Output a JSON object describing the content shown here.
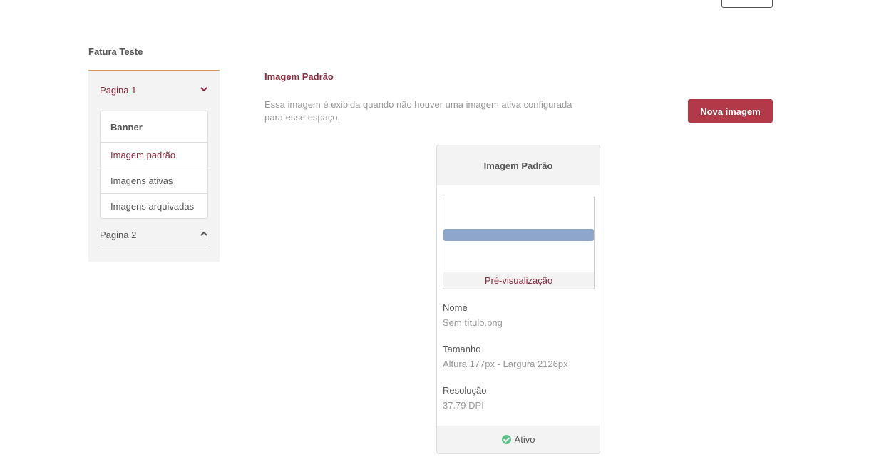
{
  "sidebar": {
    "title": "Fatura Teste",
    "pages": [
      {
        "label": "Pagina 1",
        "expanded": true,
        "chevron": "chevron-down-icon"
      },
      {
        "label": "Pagina 2",
        "expanded": false,
        "chevron": "chevron-up-icon"
      }
    ],
    "submenu": {
      "header": "Banner",
      "items": [
        "Imagem padrão",
        "Imagens ativas",
        "Imagens arquivadas"
      ],
      "active": "Imagem padrão"
    }
  },
  "main": {
    "title": "Imagem Padrão",
    "description": "Essa imagem é exibida quando não houver uma imagem ativa configurada para esse espaço.",
    "new_button": "Nova imagem"
  },
  "card": {
    "title": "Imagem Padrão",
    "preview_label": "Pré-visualização",
    "fields": [
      {
        "label": "Nome",
        "value": "Sem título.png"
      },
      {
        "label": "Tamanho",
        "value": "Altura 177px - Largura 2126px"
      },
      {
        "label": "Resolução",
        "value": "37.79 DPI"
      }
    ],
    "status": "Ativo",
    "status_icon": "check-circle-icon"
  },
  "colors": {
    "accent": "#8e2a3d",
    "button": "#b23a48",
    "active_status": "#5fc28b",
    "preview_bar": "#8ea6cb"
  }
}
